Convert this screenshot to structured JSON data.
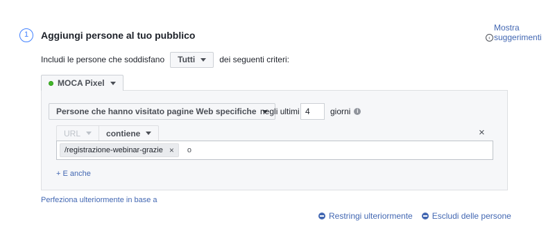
{
  "step": {
    "number": "1",
    "title": "Aggiungi persone al tuo pubblico"
  },
  "suggest": {
    "line1": "Mostra",
    "line2": "suggerimenti"
  },
  "include": {
    "prefix": "Includi le persone che soddisfano",
    "match_value": "Tutti",
    "suffix": "dei seguenti criteri:"
  },
  "source": {
    "label": "MOCA Pixel"
  },
  "rule": {
    "type_label": "Persone che hanno visitato pagine Web specifiche",
    "negli_ultimi": "negli ultimi",
    "days_value": "4",
    "giorni": "giorni",
    "info_glyph": "i"
  },
  "filter": {
    "field_label": "URL",
    "operator_label": "contiene",
    "close_glyph": "×",
    "tokens": [
      {
        "text": "/registrazione-webinar-grazie",
        "remove_glyph": "×"
      }
    ],
    "or_text": "o"
  },
  "add_also": "+ E anche",
  "refine": "Perfeziona ulteriormente in base a",
  "actions": {
    "narrow": "Restringi ulteriormente",
    "exclude": "Escludi delle persone"
  },
  "colors": {
    "accent": "#4267b2",
    "step_blue": "#4080ff",
    "pixel_green": "#42b72a"
  }
}
